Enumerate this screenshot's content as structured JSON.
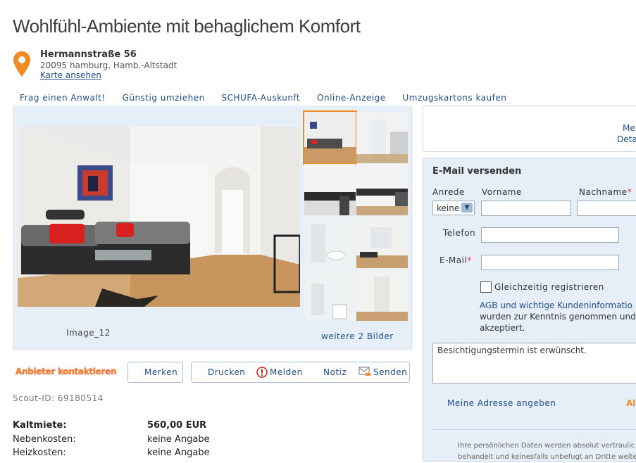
{
  "listing": {
    "title": "Wohlfühl-Ambiente mit behaglichem Komfort",
    "address": {
      "street": "Hermannstraße 56",
      "city": "20095 hamburg, Hamb.-Altstadt",
      "map_link": "Karte ansehen"
    },
    "icons": {
      "pin": "map-pin-icon",
      "alert": "alert-icon",
      "mail": "mail-icon"
    }
  },
  "topnav": [
    "Frag einen Anwalt!",
    "Günstig umziehen",
    "SCHUFA-Auskunft",
    "Online-Anzeige",
    "Umzugskartons kaufen"
  ],
  "gallery": {
    "caption": "Image_12",
    "more": "weitere 2 Bilder",
    "selected_thumb": 1
  },
  "actions": {
    "anbieter": "Anbieter kontaktieren",
    "merken": "Merken",
    "drucken": "Drucken",
    "melden": "Melden",
    "notiz": "Notiz",
    "senden": "Senden"
  },
  "scout_id": "Scout-ID: 69180514",
  "costs": [
    {
      "label": "Kaltmiete:",
      "value": "560,00 EUR",
      "bold": true
    },
    {
      "label": "Nebenkosten:",
      "value": "keine Angabe",
      "bold": false
    },
    {
      "label": "Heizkosten:",
      "value": "keine Angabe",
      "bold": false
    }
  ],
  "sidebar_top": {
    "line1": "Me",
    "line2": "Deta"
  },
  "contact": {
    "heading": "E-Mail versenden",
    "anrede_label": "Anrede",
    "anrede_value": "keine",
    "vorname_label": "Vorname",
    "nachname_label": "Nachname",
    "telefon_label": "Telefon",
    "email_label": "E-Mail",
    "required_mark": "*",
    "register_label": "Gleichzeitig registrieren",
    "agb_line1_link": "AGB und wichtige Kundeninformatio",
    "agb_line2": "wurden zur Kenntnis genommen und",
    "agb_line3": "akzeptiert.",
    "message": "Besichtigungstermin ist erwünscht.",
    "address_link": "Meine Adresse angeben",
    "absenden_partial": "Al",
    "privacy_line1": "Ihre persönlichen Daten werden absolut vertraulic",
    "privacy_line2": "behandelt und keinesfalls unbefugt an Dritte weiterge"
  },
  "colors": {
    "accent": "#f08a24",
    "link": "#1f4f8b",
    "panel": "#e6eef7",
    "border": "#c8d6e5"
  }
}
